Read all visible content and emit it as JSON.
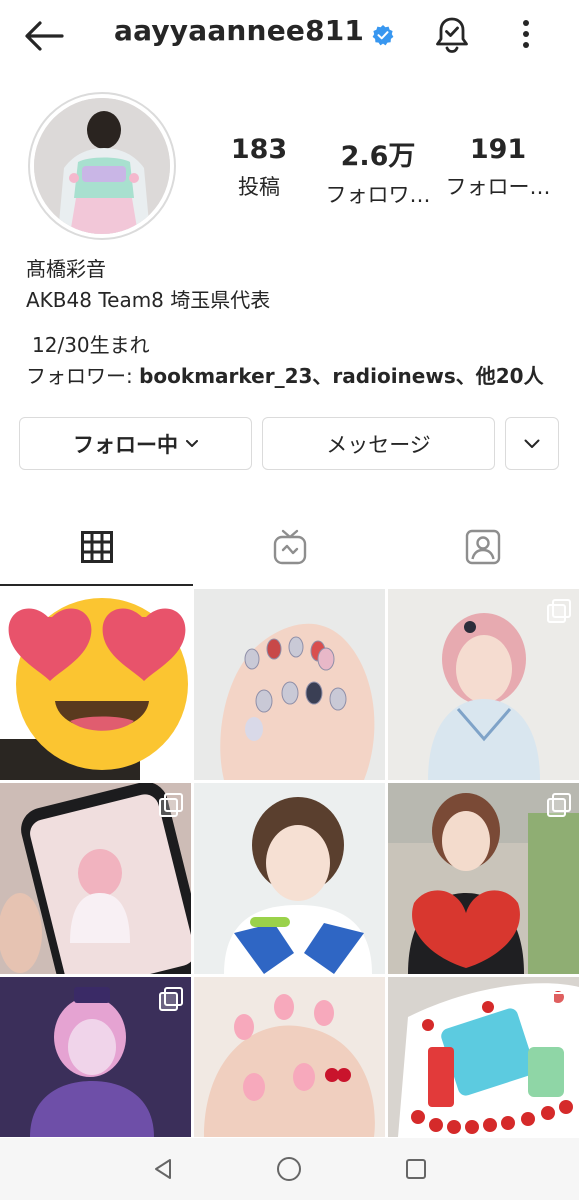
{
  "header": {
    "username": "aayyaannee811",
    "back_icon": "back-arrow-icon",
    "verified_icon": "verified-badge-icon",
    "bell_icon": "notification-bell-icon",
    "more_icon": "more-vertical-icon",
    "verified_color": "#3897f0"
  },
  "profile": {
    "stats": [
      {
        "value": "183",
        "label": "投稿"
      },
      {
        "value": "2.6万",
        "label": "フォロワ…"
      },
      {
        "value": "191",
        "label": "フォロー…"
      }
    ],
    "name": "髙橋彩音",
    "bio_line": "AKB48 Team8 埼玉県代表",
    "birthday": "12/30生まれ",
    "followed_by_prefix": "フォロワー: ",
    "followed_by_names": "bookmarker_23、radioinews、他20人"
  },
  "actions": {
    "follow_label": "フォロー中",
    "message_label": "メッセージ",
    "follow_chevron_icon": "chevron-down-icon",
    "more_chevron_icon": "chevron-down-icon"
  },
  "tabs": [
    {
      "name": "grid",
      "icon": "grid-icon",
      "active": true
    },
    {
      "name": "igtv",
      "icon": "igtv-icon",
      "active": false
    },
    {
      "name": "tagged",
      "icon": "tagged-person-icon",
      "active": false
    }
  ],
  "posts": [
    {
      "desc": "heart-eyes emoji",
      "multi": false
    },
    {
      "desc": "nail art",
      "multi": false
    },
    {
      "desc": "pink hair portrait",
      "multi": true
    },
    {
      "desc": "phone photo",
      "multi": true
    },
    {
      "desc": "portrait",
      "multi": false
    },
    {
      "desc": "holding heart",
      "multi": true
    },
    {
      "desc": "stage outfit",
      "multi": true
    },
    {
      "desc": "nail art 2",
      "multi": false
    },
    {
      "desc": "cake",
      "multi": true
    }
  ],
  "navbar": {
    "back_icon": "nav-back-triangle-icon",
    "home_icon": "nav-home-circle-icon",
    "recents_icon": "nav-recents-square-icon"
  }
}
